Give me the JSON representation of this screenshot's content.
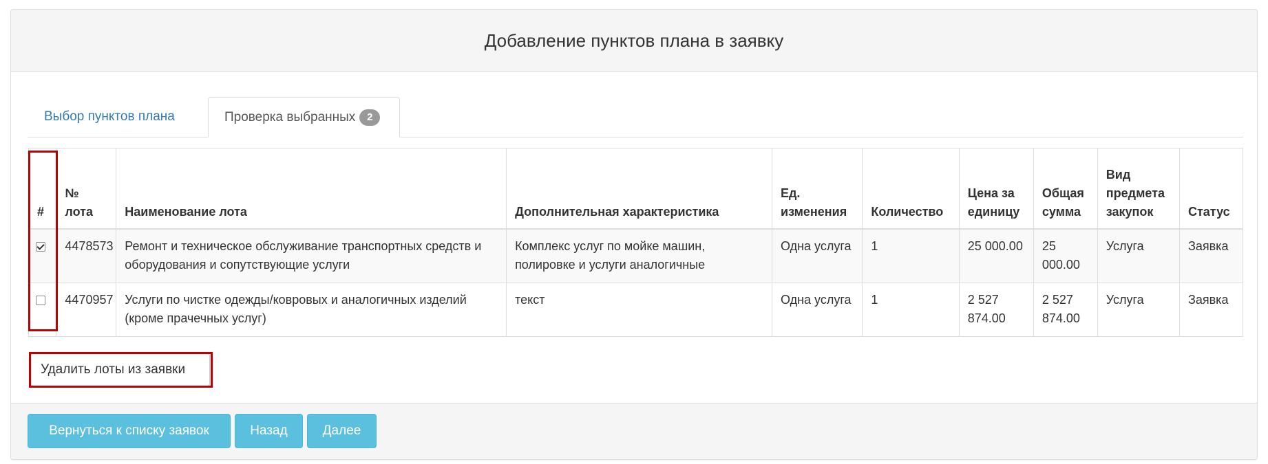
{
  "header": {
    "title": "Добавление пунктов плана в заявку"
  },
  "tabs": [
    {
      "label": "Выбор пунктов плана",
      "active": false
    },
    {
      "label": "Проверка выбранных",
      "badge": "2",
      "active": true
    }
  ],
  "table": {
    "columns": [
      "#",
      "№ лота",
      "Наименование лота",
      "Дополнительная характеристика",
      "Ед. изменения",
      "Количество",
      "Цена за единицу",
      "Общая сумма",
      "Вид предмета закупок",
      "Статус"
    ],
    "rows": [
      {
        "checked": true,
        "lot_number": "4478573",
        "name": "Ремонт и техническое обслуживание транспортных средств и оборудования и сопутствующие услуги",
        "extra": "Комплекс услуг по мойке машин, полировке и услуги аналогичные",
        "unit": "Одна услуга",
        "quantity": "1",
        "unit_price": "25 000.00",
        "total": "25 000.00",
        "procurement_type": "Услуга",
        "status": "Заявка"
      },
      {
        "checked": false,
        "lot_number": "4470957",
        "name": "Услуги по чистке одежды/ковровых и аналогичных изделий (кроме прачечных услуг)",
        "extra": "текст",
        "unit": "Одна услуга",
        "quantity": "1",
        "unit_price": "2 527 874.00",
        "total": "2 527 874.00",
        "procurement_type": "Услуга",
        "status": "Заявка"
      }
    ]
  },
  "actions": {
    "delete_label": "Удалить лоты из заявки"
  },
  "footer": {
    "back_to_list_label": "Вернуться к списку заявок",
    "back_label": "Назад",
    "next_label": "Далее"
  },
  "colors": {
    "accent_info": "#5bc0de",
    "link": "#337ab7",
    "highlight": "#c00000",
    "badge": "#999999"
  },
  "icons": [
    "checkbox-checked-icon",
    "checkbox-unchecked-icon"
  ]
}
